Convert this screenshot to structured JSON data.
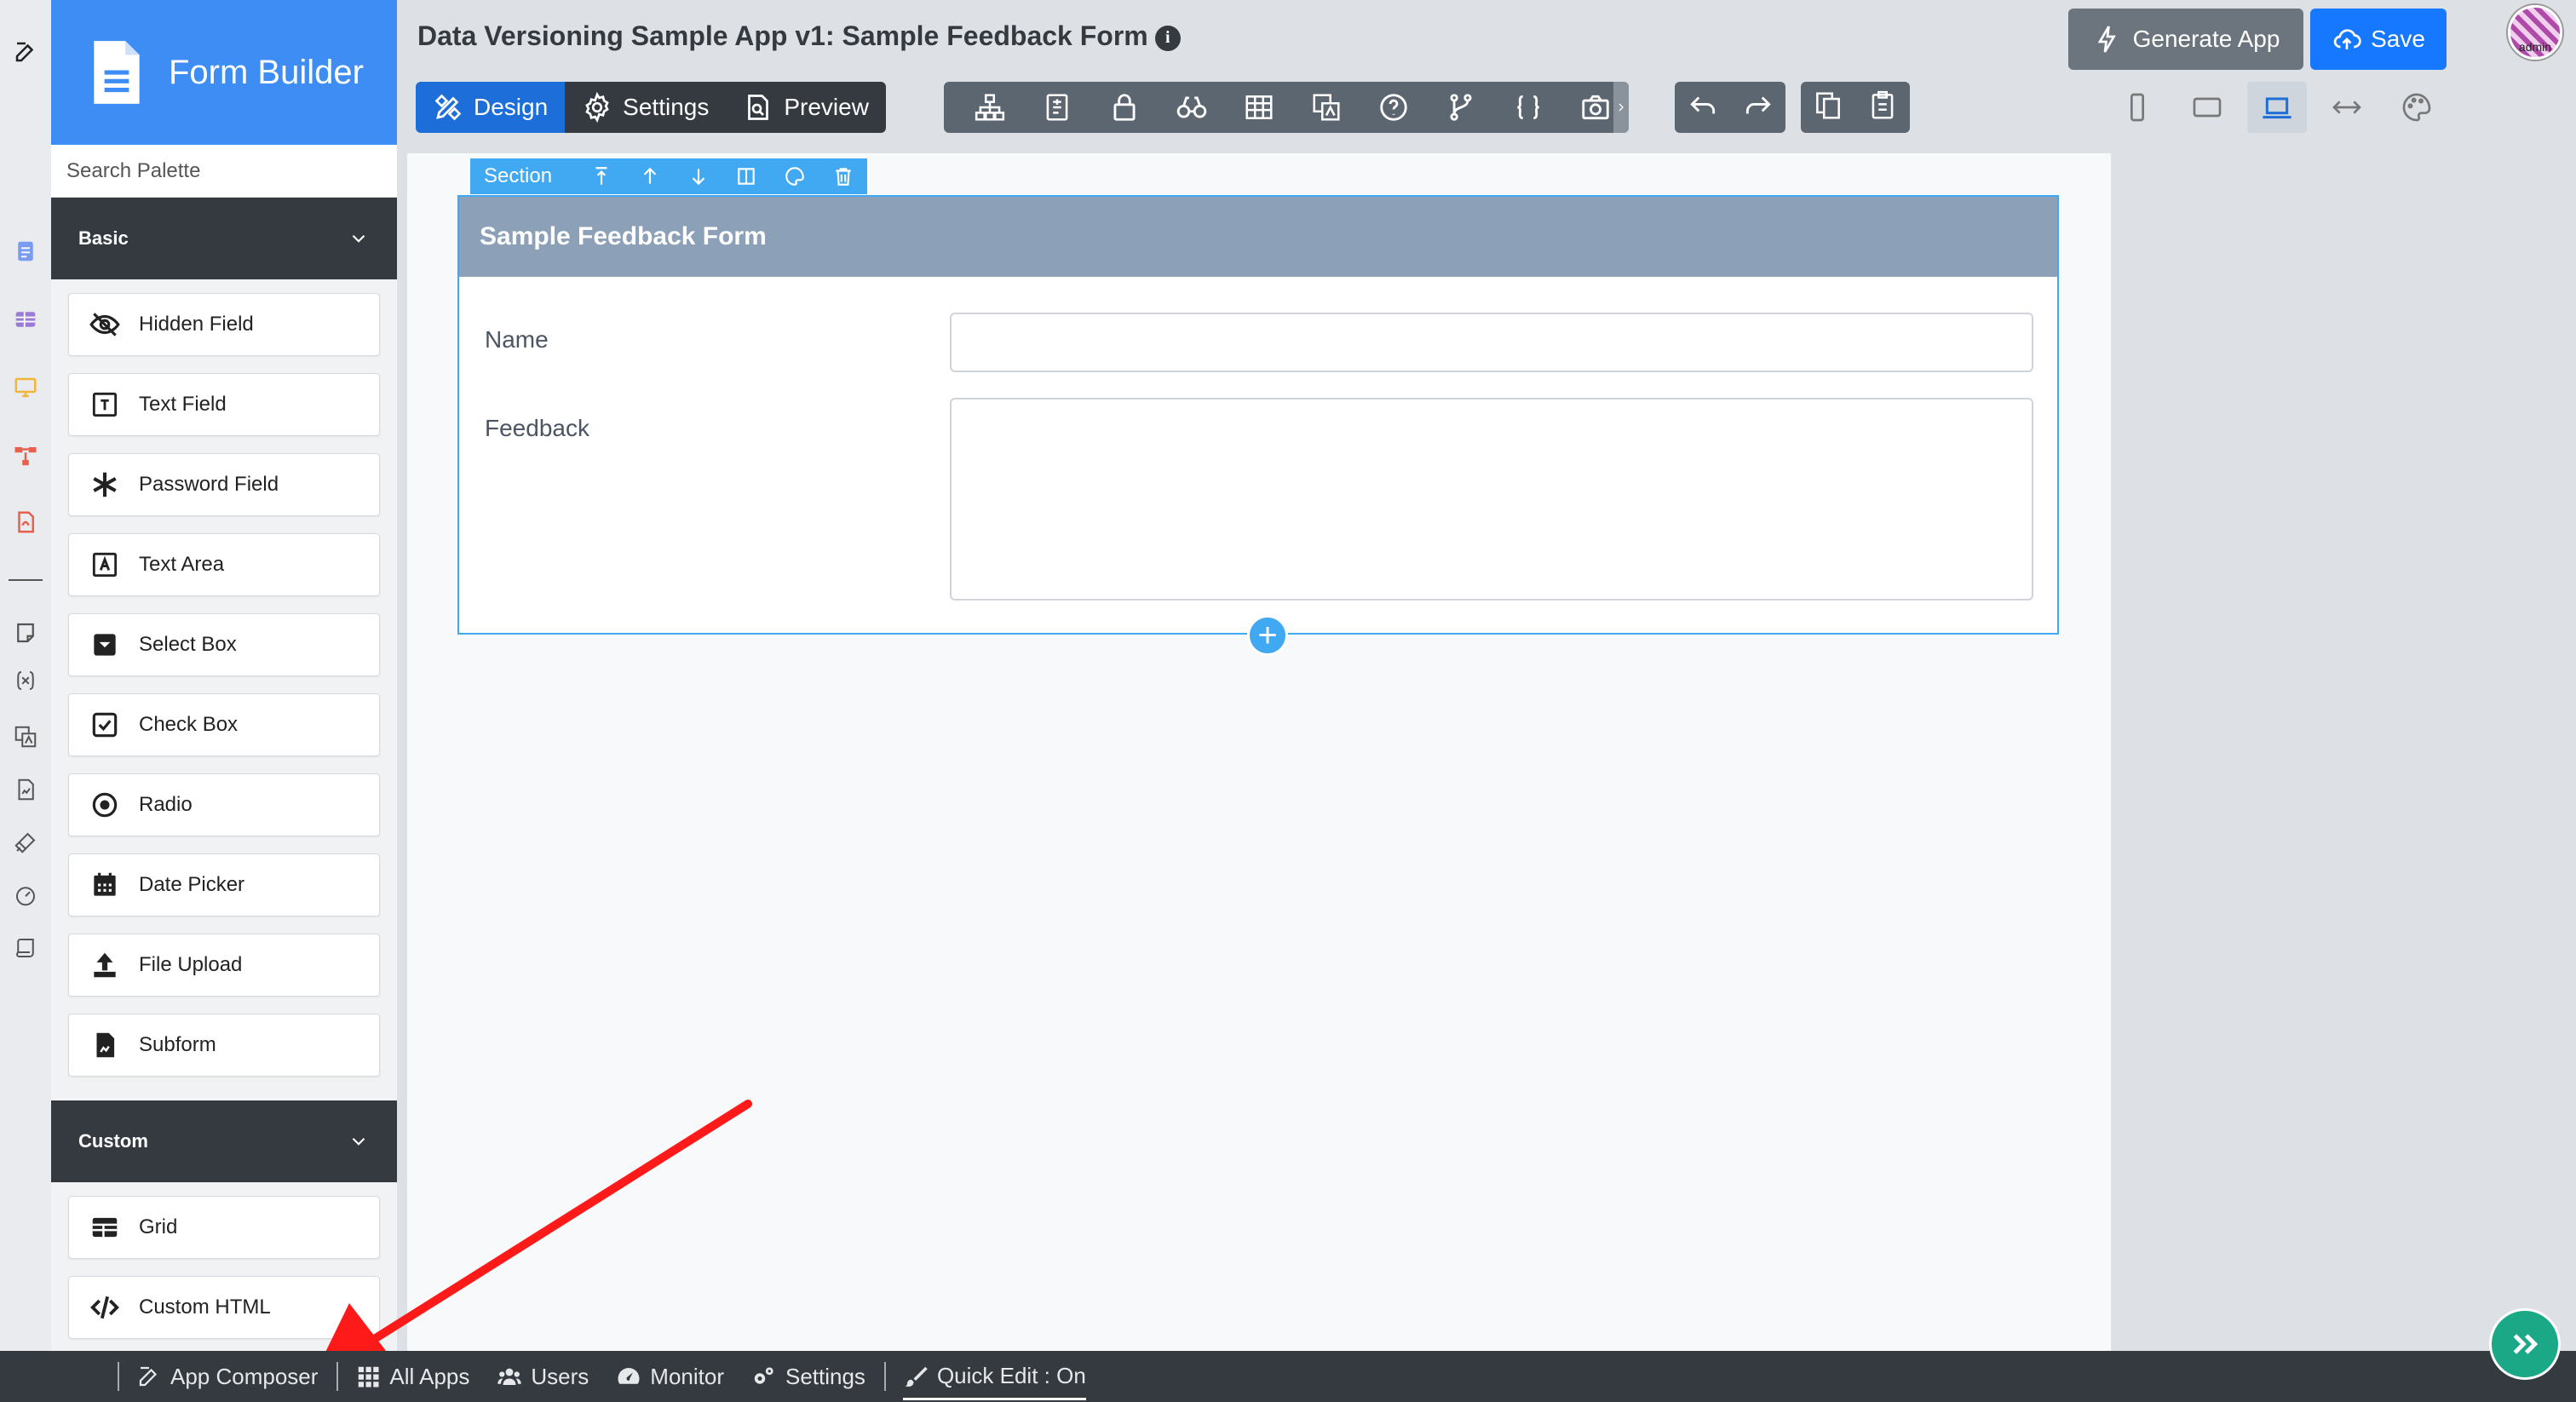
{
  "app": {
    "title": "Data Versioning Sample App v1: Sample Feedback Form",
    "brand": "Form Builder"
  },
  "palette": {
    "search_placeholder": "Search Palette",
    "categories": [
      {
        "name": "Basic",
        "items": [
          {
            "label": "Hidden Field",
            "icon": "eye-slash-icon"
          },
          {
            "label": "Text Field",
            "icon": "text-field-icon"
          },
          {
            "label": "Password Field",
            "icon": "asterisk-icon"
          },
          {
            "label": "Text Area",
            "icon": "text-area-icon"
          },
          {
            "label": "Select Box",
            "icon": "select-box-icon"
          },
          {
            "label": "Check Box",
            "icon": "check-box-icon"
          },
          {
            "label": "Radio",
            "icon": "radio-icon"
          },
          {
            "label": "Date Picker",
            "icon": "calendar-icon"
          },
          {
            "label": "File Upload",
            "icon": "upload-icon"
          },
          {
            "label": "Subform",
            "icon": "subform-icon"
          }
        ]
      },
      {
        "name": "Custom",
        "items": [
          {
            "label": "Grid",
            "icon": "grid-icon"
          },
          {
            "label": "Custom HTML",
            "icon": "code-icon"
          }
        ]
      }
    ]
  },
  "modes": {
    "design": "Design",
    "settings": "Settings",
    "preview": "Preview",
    "active": "Design"
  },
  "actions": {
    "generate": "Generate App",
    "save": "Save"
  },
  "avatar": {
    "label": "admin"
  },
  "section": {
    "toolbar_label": "Section",
    "title": "Sample Feedback Form",
    "fields": [
      {
        "label": "Name",
        "type": "text",
        "value": ""
      },
      {
        "label": "Feedback",
        "type": "textarea",
        "value": ""
      }
    ]
  },
  "bottom_bar": {
    "app_composer": "App Composer",
    "all_apps": "All Apps",
    "users": "Users",
    "monitor": "Monitor",
    "settings": "Settings",
    "quick_edit": "Quick Edit : On"
  },
  "colors": {
    "brand_blue": "#3d8df5",
    "active_mode": "#1d6ed8",
    "section_accent": "#41a8f2",
    "section_header": "#8ca0b8",
    "dark": "#343a40",
    "annotation_arrow": "#ff1a1a",
    "fab": "#1aa887"
  }
}
